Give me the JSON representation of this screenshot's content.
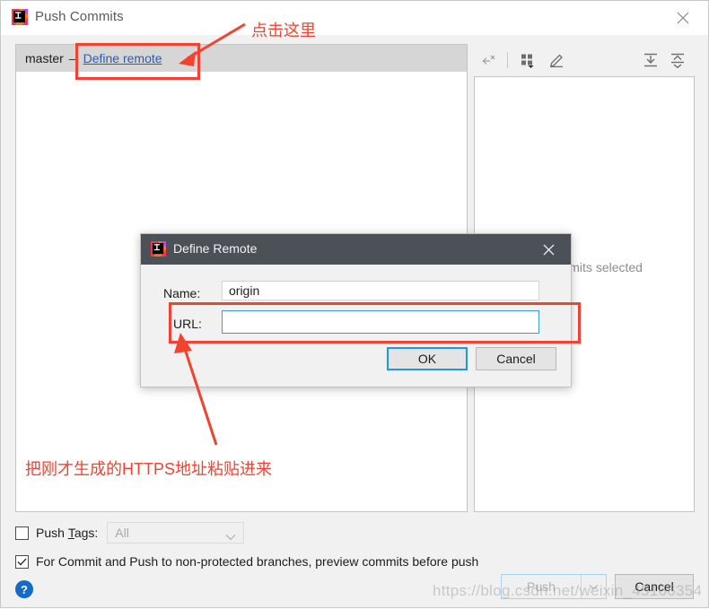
{
  "window": {
    "title": "Push Commits",
    "icon": "intellij-idea-icon",
    "close_icon": "close-icon"
  },
  "left_panel": {
    "branch": "master",
    "separator": "–",
    "define_remote_link": "Define remote"
  },
  "right_panel": {
    "toolbar": [
      {
        "name": "collapse-selection-icon",
        "tooltip": "Collapse"
      },
      {
        "name": "group-by-icon",
        "tooltip": "Group By"
      },
      {
        "name": "edit-icon",
        "tooltip": "Edit"
      },
      {
        "name": "expand-all-icon",
        "tooltip": "Expand All"
      },
      {
        "name": "collapse-all-icon",
        "tooltip": "Collapse All"
      }
    ],
    "empty_message": "No commits selected"
  },
  "options": {
    "push_tags_label_pre": "Push ",
    "push_tags_label_mnemonic": "T",
    "push_tags_label_post": "ags:",
    "push_tags_checked": false,
    "push_tags_value": "All",
    "push_tags_options": [
      "All"
    ],
    "preview_label": "For Commit and Push to non-protected branches, preview commits before push",
    "preview_checked": true
  },
  "footer": {
    "help_glyph": "?",
    "push_label": "Push",
    "push_dropdown_icon": "chevron-down-icon",
    "cancel_label": "Cancel"
  },
  "modal": {
    "title": "Define Remote",
    "icon": "intellij-idea-icon",
    "close_icon": "close-icon",
    "name_label": "Name:",
    "name_value": "origin",
    "url_label": "URL:",
    "url_value": "",
    "ok_label": "OK",
    "cancel_label": "Cancel"
  },
  "annotations": {
    "top_text": "点击这里",
    "bottom_text": "把刚才生成的HTTPS地址粘贴进来",
    "color": "#f2432e"
  },
  "watermark": {
    "text": "https://blog.csdn.net/weixin_45166354"
  }
}
